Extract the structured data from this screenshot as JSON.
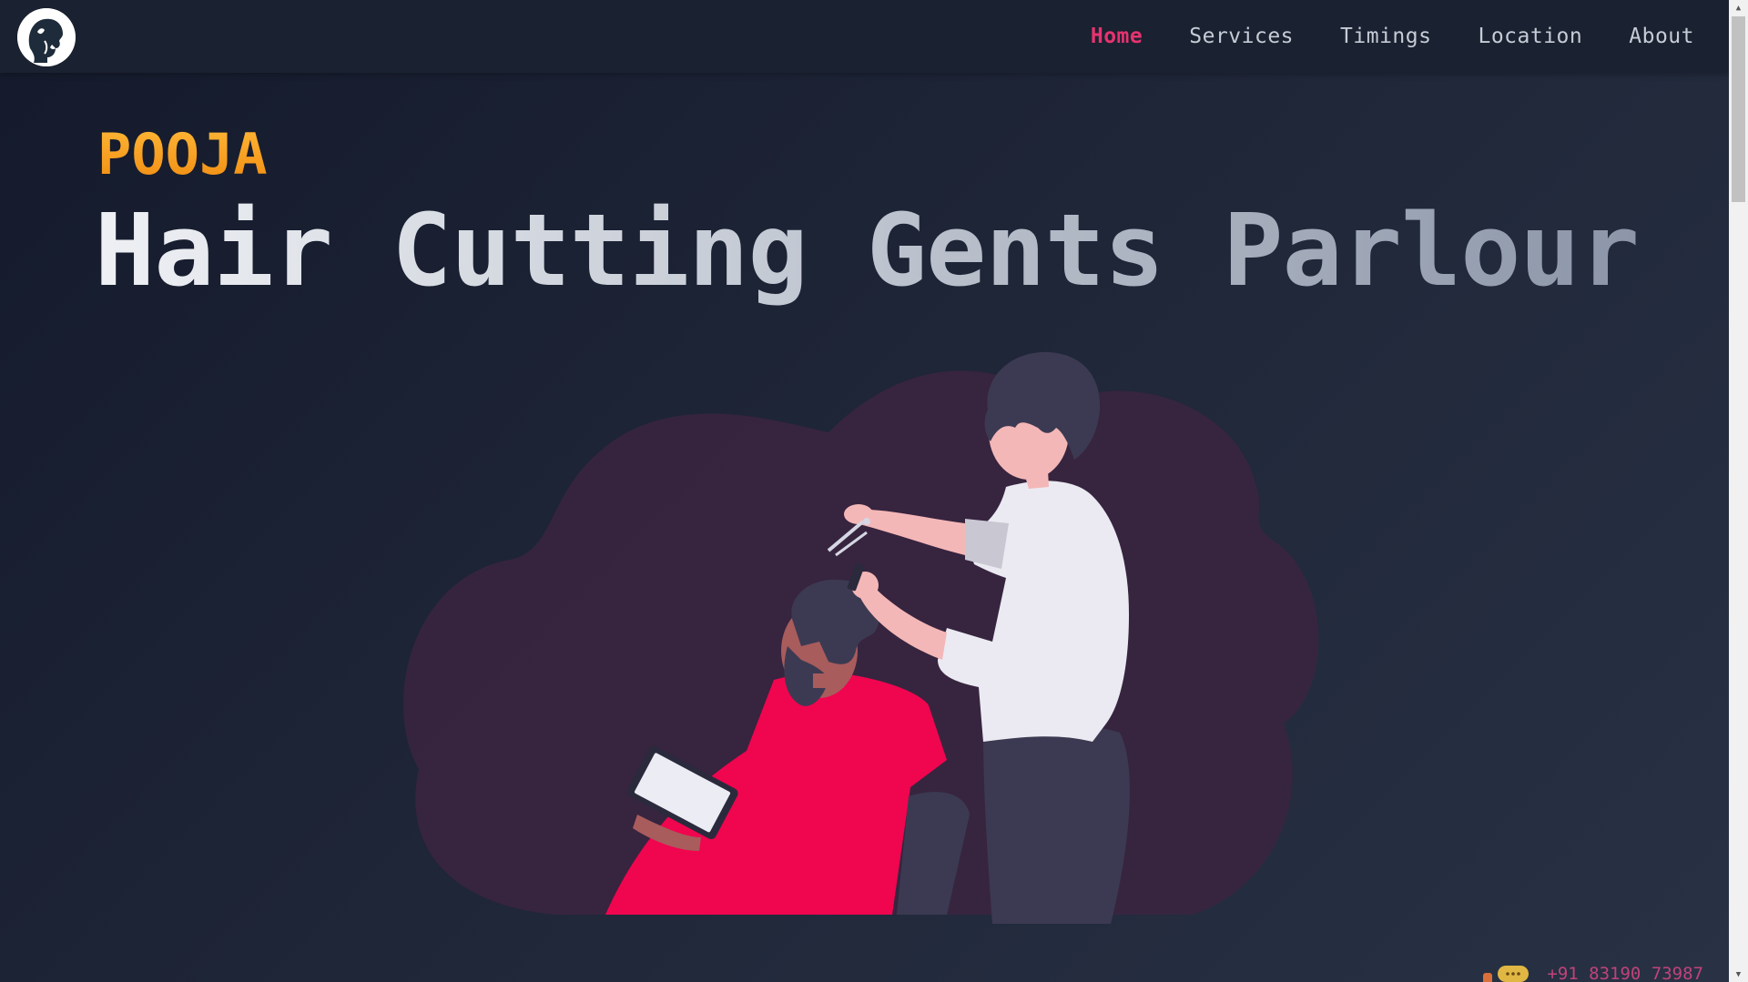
{
  "navbar": {
    "logo_icon": "barber-head-logo-icon",
    "links": [
      {
        "label": "Home",
        "active": true
      },
      {
        "label": "Services",
        "active": false
      },
      {
        "label": "Timings",
        "active": false
      },
      {
        "label": "Location",
        "active": false
      },
      {
        "label": "About",
        "active": false
      }
    ]
  },
  "hero": {
    "eyebrow": "POOJA",
    "title": "Hair Cutting Gents Parlour",
    "illustration_icon": "barber-cutting-hair-illustration"
  },
  "contact": {
    "icon": "chat-bubble-icon",
    "phone": "+91 83190 73987"
  },
  "colors": {
    "accent_active": "#e6336f",
    "eyebrow_gradient_start": "#ffb938",
    "eyebrow_gradient_end": "#f08a10",
    "background_dark": "#141a2b",
    "navbar_bg": "#1a2130",
    "cape_red": "#f0054f",
    "blob": "#3a2540"
  }
}
